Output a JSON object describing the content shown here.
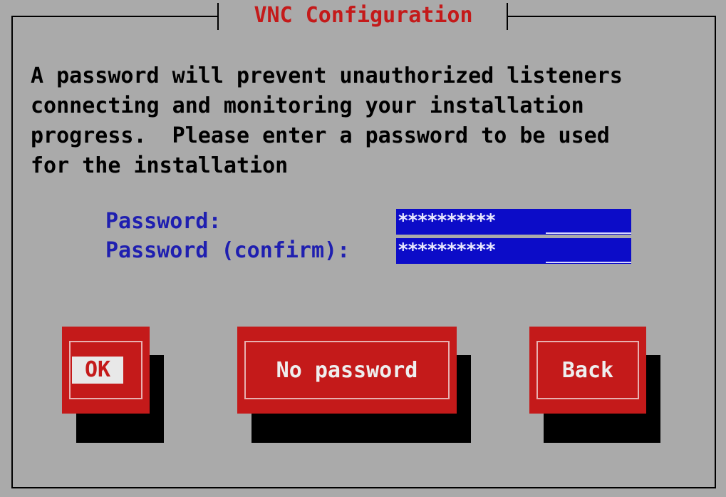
{
  "dialog": {
    "title": "VNC Configuration",
    "message_lines": [
      "A password will prevent unauthorized listeners",
      "connecting and monitoring your installation",
      "progress.  Please enter a password to be used",
      "for the installation"
    ]
  },
  "form": {
    "password_label": "Password:",
    "password_confirm_label": "Password (confirm):",
    "password_value": "**********",
    "password_confirm_value": "**********"
  },
  "buttons": {
    "ok_label": "OK",
    "no_password_label": "No password",
    "back_label": "Back"
  },
  "colors": {
    "background": "#aaaaaa",
    "title": "#c41a1a",
    "label": "#1f1fb0",
    "field": "#0c0cc8",
    "button": "#c41a1a"
  }
}
